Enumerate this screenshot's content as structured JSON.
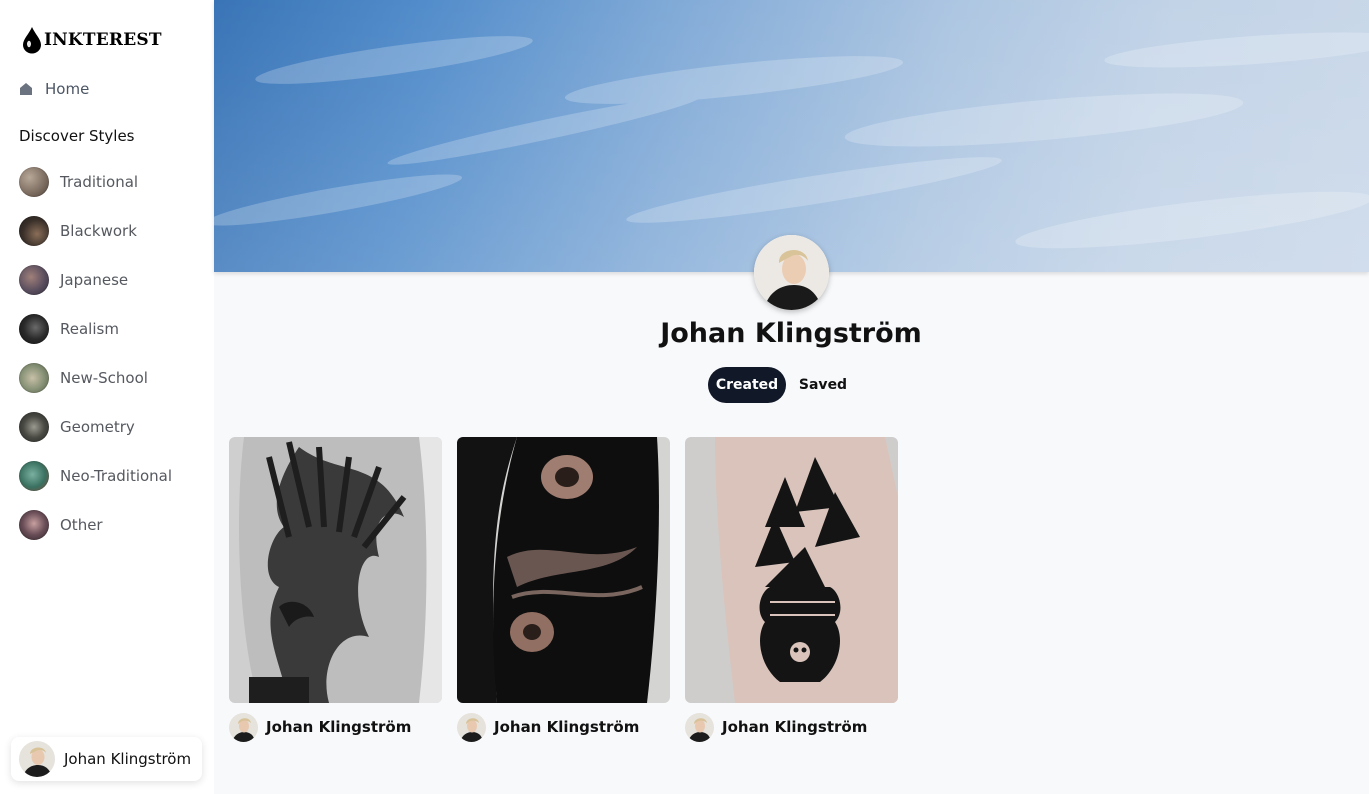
{
  "app": {
    "logo_text": "INKTEREST",
    "brand_color": "#000000"
  },
  "sidebar": {
    "home_label": "Home",
    "section_title": "Discover Styles",
    "styles": [
      {
        "label": "Traditional",
        "icon": "style-thumb-traditional",
        "color": "#8a7a6e"
      },
      {
        "label": "Blackwork",
        "icon": "style-thumb-blackwork",
        "color": "#4a3f38"
      },
      {
        "label": "Japanese",
        "icon": "style-thumb-japanese",
        "color": "#6b5a4f"
      },
      {
        "label": "Realism",
        "icon": "style-thumb-realism",
        "color": "#2a2a2a"
      },
      {
        "label": "New-School",
        "icon": "style-thumb-new-school",
        "color": "#8f9a7e"
      },
      {
        "label": "Geometry",
        "icon": "style-thumb-geometry",
        "color": "#5a5a52"
      },
      {
        "label": "Neo-Traditional",
        "icon": "style-thumb-neo-traditional",
        "color": "#3d7a6e"
      },
      {
        "label": "Other",
        "icon": "style-thumb-other",
        "color": "#6e5a60"
      }
    ],
    "current_user": "Johan Klingström"
  },
  "profile": {
    "name": "Johan Klingström",
    "tabs": {
      "created": "Created",
      "saved": "Saved"
    },
    "active_tab": "Created"
  },
  "pins": [
    {
      "author": "Johan Klingström",
      "image": "eagle-back-tattoo"
    },
    {
      "author": "Johan Klingström",
      "image": "blackwork-sleeve-tattoo"
    },
    {
      "author": "Johan Klingström",
      "image": "ginkgo-vase-tattoo"
    }
  ],
  "colors": {
    "tab_active_bg": "#111827",
    "page_bg": "#f8f9fb"
  }
}
